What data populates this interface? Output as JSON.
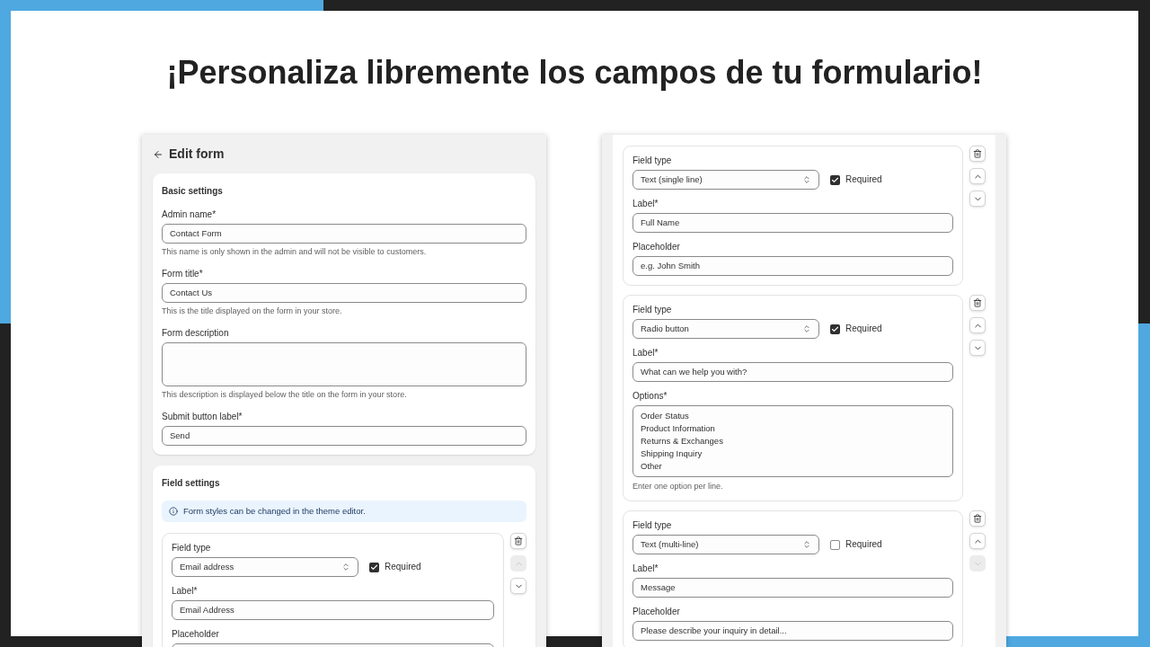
{
  "heading": "¡Personaliza libremente los campos de tu formulario!",
  "edit_form": {
    "title": "Edit form",
    "basic_settings": {
      "title": "Basic settings",
      "fields": [
        {
          "kind": "input",
          "label": "Admin name*",
          "value": "Contact Form",
          "help": "This name is only shown in the admin and will not be visible to customers."
        },
        {
          "kind": "input",
          "label": "Form title*",
          "value": "Contact Us",
          "help": "This is the title displayed on the form in your store."
        },
        {
          "kind": "textarea",
          "label": "Form description",
          "help": "This description is displayed below the title on the form in your store."
        },
        {
          "kind": "input",
          "label": "Submit button label*",
          "value": "Send"
        }
      ]
    },
    "field_settings": {
      "title": "Field settings",
      "notice": "Form styles can be changed in the theme editor.",
      "fields": [
        {
          "type_label": "Field type",
          "type": "Email address",
          "required_label": "Required",
          "required": true,
          "label_label": "Label*",
          "label": "Email Address",
          "extra": {
            "kind": "placeholder",
            "label": "Placeholder"
          },
          "up_disabled": true,
          "down_disabled": false
        }
      ]
    }
  },
  "fields_panel": {
    "fields": [
      {
        "type_label": "Field type",
        "type": "Text (single line)",
        "required_label": "Required",
        "required": true,
        "label_label": "Label*",
        "label": "Full Name",
        "extra": {
          "kind": "placeholder",
          "label": "Placeholder",
          "value": "e.g. John Smith"
        },
        "up_disabled": false,
        "down_disabled": false
      },
      {
        "type_label": "Field type",
        "type": "Radio button",
        "required_label": "Required",
        "required": true,
        "label_label": "Label*",
        "label": "What can we help you with?",
        "extra": {
          "kind": "options",
          "label": "Options*",
          "options": [
            "Order Status",
            "Product Information",
            "Returns & Exchanges",
            "Shipping Inquiry",
            "Other"
          ],
          "help": "Enter one option per line."
        },
        "up_disabled": false,
        "down_disabled": false
      },
      {
        "type_label": "Field type",
        "type": "Text (multi-line)",
        "required_label": "Required",
        "required": false,
        "label_label": "Label*",
        "label": "Message",
        "extra": {
          "kind": "placeholder",
          "label": "Placeholder",
          "value": "Please describe your inquiry in detail..."
        },
        "up_disabled": false,
        "down_disabled": true
      }
    ]
  }
}
